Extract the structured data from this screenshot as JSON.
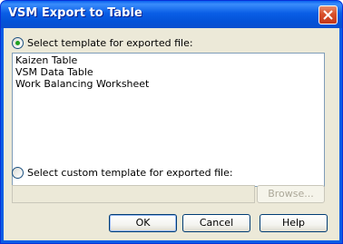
{
  "window": {
    "title": "VSM Export to Table"
  },
  "template_option": {
    "label": "Select template for exported file:",
    "selected": true
  },
  "template_list": {
    "items": [
      "Kaizen Table",
      "VSM Data Table",
      "Work Balancing Worksheet"
    ]
  },
  "custom_option": {
    "label": "Select custom template for exported file:",
    "selected": false
  },
  "custom_path": {
    "value": ""
  },
  "buttons": {
    "browse": "Browse...",
    "ok": "OK",
    "cancel": "Cancel",
    "help": "Help"
  },
  "icons": {
    "close": "close-icon"
  }
}
